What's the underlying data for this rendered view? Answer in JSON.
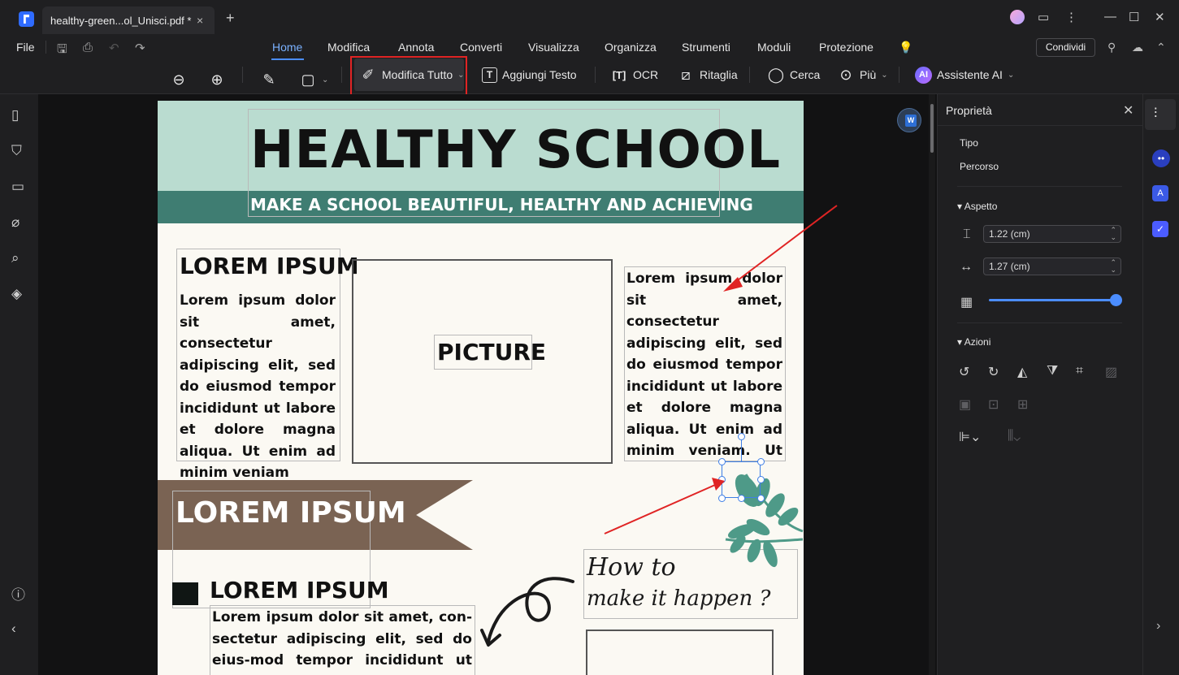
{
  "titlebar": {
    "tab_title": "healthy-green...ol_Unisci.pdf *",
    "tab_close": "×",
    "new_tab": "+"
  },
  "menu": {
    "file": "File",
    "items": [
      "Home",
      "Modifica",
      "Annota",
      "Converti",
      "Visualizza",
      "Organizza",
      "Strumenti",
      "Moduli",
      "Protezione"
    ],
    "share": "Condividi"
  },
  "toolbar": {
    "edit_all": "Modifica Tutto",
    "add_text": "Aggiungi Testo",
    "ocr": "OCR",
    "crop": "Ritaglia",
    "search": "Cerca",
    "more": "Più",
    "ai": "Assistente AI",
    "ai_badge": "AI"
  },
  "props": {
    "title": "Proprietà",
    "type_label": "Tipo",
    "type_value": "Percorso",
    "appearance": "Aspetto",
    "height": "1.22 (cm)",
    "width": "1.27 (cm)",
    "opacity": 1.0,
    "actions": "Azioni"
  },
  "document": {
    "title": "HEALTHY SCHOOL",
    "subtitle": "MAKE A SCHOOL BEAUTIFUL, HEALTHY AND ACHIEVING",
    "left_heading": "LOREM IPSUM",
    "left_body": "Lorem ipsum dolor sit amet, consectetur adipiscing elit, sed do eiusmod tempor incididunt ut labore et dolore magna aliqua. Ut enim ad minim veniam",
    "picture": "PICTURE",
    "right_body": "Lorem ipsum dolor sit amet, consectetur adipiscing elit, sed do eiusmod tempor incididunt ut labore et dolore magna aliqua. Ut enim ad minim veniam. Ut enim ad minim",
    "banner": "LOREM IPSUM",
    "section_heading": "LOREM IPSUM",
    "bottom_body": "Lorem ipsum dolor sit amet, con-sectetur adipiscing elit, sed do eius-mod tempor incididunt ut labore et",
    "script_line1": "How to",
    "script_line2": "make it happen ?"
  },
  "colors": {
    "header_band": "#badcd0",
    "subtitle_band": "#3f7d72",
    "banner": "#7a6353",
    "leaf": "#4e9a88",
    "accent": "#4b8dff",
    "highlight": "#e02424"
  }
}
